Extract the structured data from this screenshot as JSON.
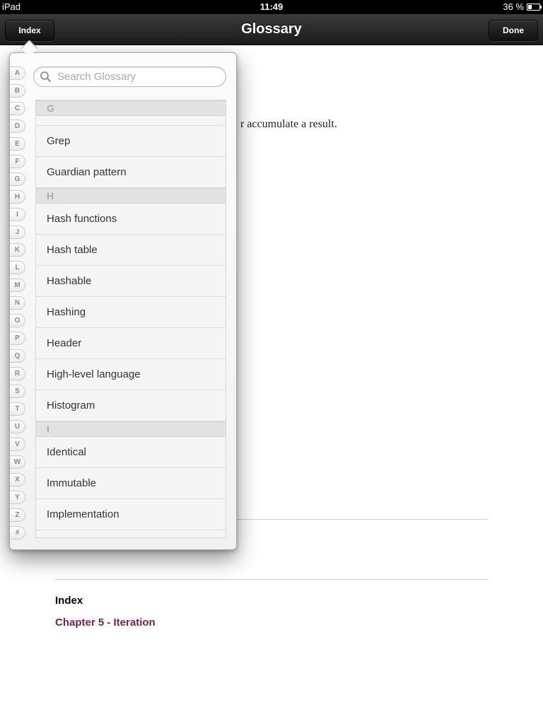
{
  "status_bar": {
    "carrier": "iPad",
    "time": "11:49",
    "battery": "36 %"
  },
  "nav": {
    "title": "Glossary",
    "index_button": "Index",
    "done_button": "Done"
  },
  "document": {
    "visible_text": "r accumulate a result.",
    "heading": "Index",
    "link": "Chapter 5 - Iteration"
  },
  "popover": {
    "search": {
      "placeholder": "Search Glossary",
      "value": ""
    },
    "alphabet": [
      "A",
      "B",
      "C",
      "D",
      "E",
      "F",
      "G",
      "H",
      "I",
      "J",
      "K",
      "L",
      "M",
      "N",
      "O",
      "P",
      "Q",
      "R",
      "S",
      "T",
      "U",
      "V",
      "W",
      "X",
      "Y",
      "Z",
      "#"
    ],
    "sections": [
      {
        "header": "G",
        "items": [
          "Grep",
          "Guardian pattern"
        ]
      },
      {
        "header": "H",
        "items": [
          "Hash functions",
          "Hash table",
          "Hashable",
          "Hashing",
          "Header",
          "High-level language",
          "Histogram"
        ]
      },
      {
        "header": "I",
        "items": [
          "Identical",
          "Immutable",
          "Implementation"
        ]
      }
    ]
  },
  "colors": {
    "nav_bar": "#2a2a2a",
    "link": "#7a1f4c"
  }
}
